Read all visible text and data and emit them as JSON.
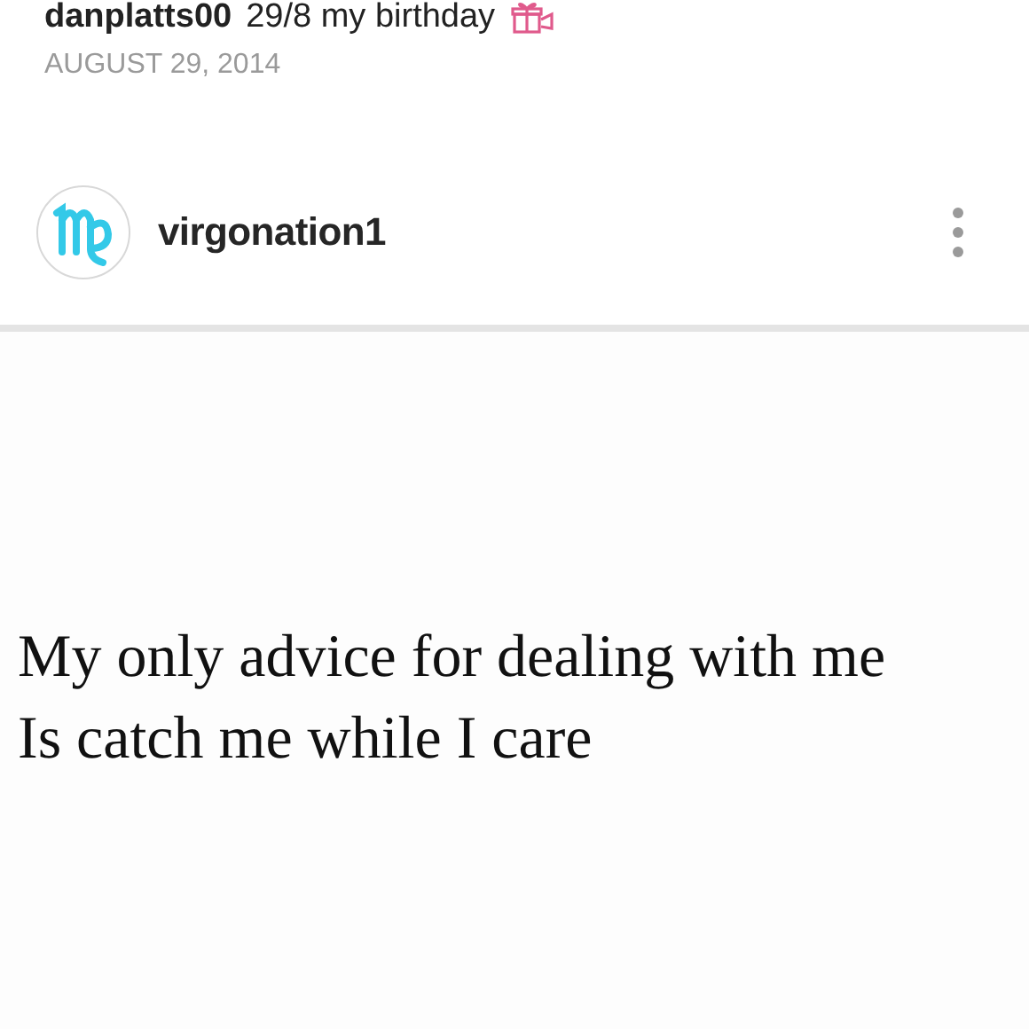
{
  "previous_post": {
    "caption_user": "danplatts00",
    "caption": "29/8 my birthday",
    "date": "AUGUST 29, 2014"
  },
  "post": {
    "username": "virgonation1",
    "quote_lines": [
      "My only advice for dealing with me",
      "Is catch me while I care"
    ]
  }
}
